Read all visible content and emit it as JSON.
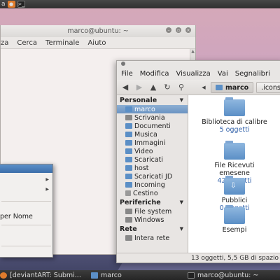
{
  "top_panel": {
    "app_label": "a",
    "launcher_icons": [
      "firefox-icon",
      "terminal-icon"
    ]
  },
  "terminal": {
    "title": "marco@ubuntu: ~",
    "menu": [
      "za",
      "Cerca",
      "Terminale",
      "Aiuto"
    ]
  },
  "popup_menu": {
    "items": [
      "",
      "",
      "",
      "per Nome",
      "",
      ""
    ]
  },
  "nautilus": {
    "menu": [
      "File",
      "Modifica",
      "Visualizza",
      "Vai",
      "Segnalibri"
    ],
    "path": [
      "marco",
      ".icons"
    ],
    "sidebar": {
      "sections": [
        {
          "title": "Personale",
          "items": [
            "marco",
            "Scrivania",
            "Documenti",
            "Musica",
            "Immagini",
            "Video",
            "Scaricati",
            "host",
            "Scaricati JD",
            "Incoming",
            "Cestino"
          ]
        },
        {
          "title": "Periferiche",
          "items": [
            "File system",
            "Windows"
          ]
        },
        {
          "title": "Rete",
          "items": [
            "Intera rete"
          ]
        }
      ]
    },
    "files": [
      {
        "name": "Biblioteca di calibre",
        "count": "5 oggetti"
      },
      {
        "name": "File Ricevuti emesene",
        "count": "42 oggetti"
      },
      {
        "name": "Pubblici",
        "count": "0 oggetti"
      },
      {
        "name": "Esempi",
        "count": ""
      }
    ],
    "status": "13 oggetti, 5,5 GB di spazio"
  },
  "taskbar": {
    "tasks": [
      "[deviantART: Submi...",
      "marco",
      "marco@ubuntu: ~"
    ]
  }
}
